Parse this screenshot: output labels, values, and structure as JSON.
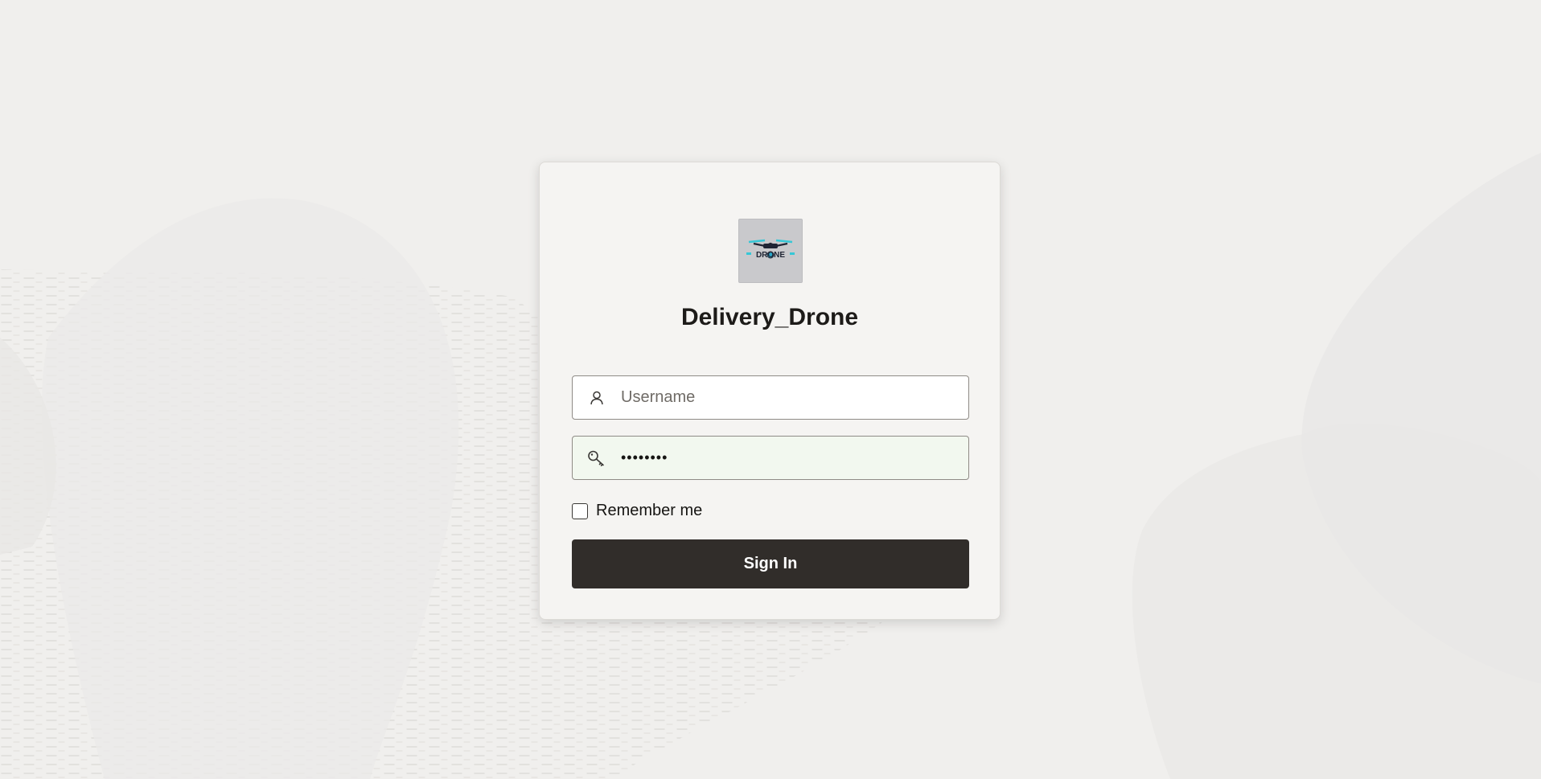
{
  "app": {
    "title": "Delivery_Drone",
    "logo_text": "DRONE"
  },
  "form": {
    "username_placeholder": "Username",
    "username_value": "",
    "password_value": "••••••••",
    "remember_label": "Remember me",
    "remember_checked": false,
    "signin_label": "Sign In"
  },
  "colors": {
    "background": "#f0efed",
    "card": "#f5f4f2",
    "button": "#312d2a",
    "password_fill": "#f2f8ef"
  },
  "icons": {
    "username": "user-icon",
    "password": "key-icon"
  }
}
